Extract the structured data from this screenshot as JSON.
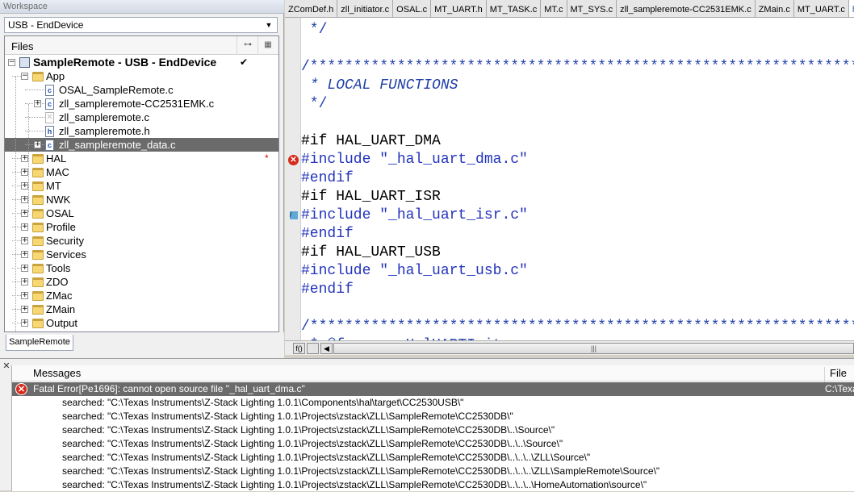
{
  "workspace": {
    "title": "Workspace",
    "config_select": "USB - EndDevice",
    "files_header": "Files",
    "tree": [
      {
        "label": "SampleRemote - USB - EndDevice",
        "type": "project",
        "level": 0,
        "expander": "−",
        "mark": "✔"
      },
      {
        "label": "App",
        "type": "folder",
        "level": 1,
        "expander": "−"
      },
      {
        "label": "OSAL_SampleRemote.c",
        "type": "file",
        "level": 2,
        "expander": ""
      },
      {
        "label": "zll_sampleremote-CC2531EMK.c",
        "type": "file",
        "level": 2,
        "expander": "+"
      },
      {
        "label": "zll_sampleremote.c",
        "type": "file-x",
        "level": 2,
        "expander": ""
      },
      {
        "label": "zll_sampleremote.h",
        "type": "file",
        "level": 2,
        "expander": ""
      },
      {
        "label": "zll_sampleremote_data.c",
        "type": "file",
        "level": 2,
        "expander": "+",
        "selected": true
      },
      {
        "label": "HAL",
        "type": "folder",
        "level": 1,
        "expander": "+",
        "mark": "*"
      },
      {
        "label": "MAC",
        "type": "folder",
        "level": 1,
        "expander": "+"
      },
      {
        "label": "MT",
        "type": "folder",
        "level": 1,
        "expander": "+"
      },
      {
        "label": "NWK",
        "type": "folder",
        "level": 1,
        "expander": "+"
      },
      {
        "label": "OSAL",
        "type": "folder",
        "level": 1,
        "expander": "+"
      },
      {
        "label": "Profile",
        "type": "folder",
        "level": 1,
        "expander": "+"
      },
      {
        "label": "Security",
        "type": "folder",
        "level": 1,
        "expander": "+"
      },
      {
        "label": "Services",
        "type": "folder",
        "level": 1,
        "expander": "+"
      },
      {
        "label": "Tools",
        "type": "folder",
        "level": 1,
        "expander": "+"
      },
      {
        "label": "ZDO",
        "type": "folder",
        "level": 1,
        "expander": "+"
      },
      {
        "label": "ZMac",
        "type": "folder",
        "level": 1,
        "expander": "+"
      },
      {
        "label": "ZMain",
        "type": "folder",
        "level": 1,
        "expander": "+"
      },
      {
        "label": "Output",
        "type": "folder",
        "level": 1,
        "expander": "+"
      }
    ],
    "bottom_tab": "SampleRemote"
  },
  "editor": {
    "tabs": [
      {
        "label": "ZComDef.h"
      },
      {
        "label": "zll_initiator.c"
      },
      {
        "label": "OSAL.c"
      },
      {
        "label": "MT_UART.h"
      },
      {
        "label": "MT_TASK.c"
      },
      {
        "label": "MT.c"
      },
      {
        "label": "MT_SYS.c"
      },
      {
        "label": "zll_sampleremote-CC2531EMK.c"
      },
      {
        "label": "ZMain.c"
      },
      {
        "label": "MT_UART.c"
      },
      {
        "label": "hal_u",
        "active": true
      }
    ],
    "code_lines": [
      {
        "text": " */",
        "cls": "comment"
      },
      {
        "text": "",
        "cls": ""
      },
      {
        "text": "/*******************************************************************",
        "cls": "comment"
      },
      {
        "text": " * LOCAL FUNCTIONS",
        "cls": "comment it"
      },
      {
        "text": " */",
        "cls": "comment"
      },
      {
        "text": "",
        "cls": ""
      },
      {
        "text": "#if HAL_UART_DMA",
        "cls": "kw"
      },
      {
        "text": "#include \"_hal_uart_dma.c\"",
        "cls": "pp",
        "marker": "error"
      },
      {
        "text": "#endif",
        "cls": "pp"
      },
      {
        "text": "#if HAL_UART_ISR",
        "cls": "kw"
      },
      {
        "text": "#include \"_hal_uart_isr.c\"",
        "cls": "pp",
        "marker": "bookmark"
      },
      {
        "text": "#endif",
        "cls": "pp"
      },
      {
        "text": "#if HAL_UART_USB",
        "cls": "kw"
      },
      {
        "text": "#include \"_hal_uart_usb.c\"",
        "cls": "pp"
      },
      {
        "text": "#endif",
        "cls": "pp"
      },
      {
        "text": "",
        "cls": ""
      },
      {
        "text": "/*******************************************************************",
        "cls": "comment"
      },
      {
        "text": " * @fn      HalUARTInit",
        "cls": "comment"
      }
    ],
    "scroll_label": "f()"
  },
  "messages": {
    "col_messages": "Messages",
    "col_file": "File",
    "rows": [
      {
        "text": "Fatal Error[Pe1696]: cannot open source file \"_hal_uart_dma.c\"",
        "file": "C:\\Texas",
        "error": true,
        "selected": true
      },
      {
        "text": "searched: \"C:\\Texas Instruments\\Z-Stack Lighting 1.0.1\\Components\\hal\\target\\CC2530USB\\\"",
        "file": ""
      },
      {
        "text": "searched: \"C:\\Texas Instruments\\Z-Stack Lighting 1.0.1\\Projects\\zstack\\ZLL\\SampleRemote\\CC2530DB\\\"",
        "file": ""
      },
      {
        "text": "searched: \"C:\\Texas Instruments\\Z-Stack Lighting 1.0.1\\Projects\\zstack\\ZLL\\SampleRemote\\CC2530DB\\..\\Source\\\"",
        "file": ""
      },
      {
        "text": "searched: \"C:\\Texas Instruments\\Z-Stack Lighting 1.0.1\\Projects\\zstack\\ZLL\\SampleRemote\\CC2530DB\\..\\..\\Source\\\"",
        "file": ""
      },
      {
        "text": "searched: \"C:\\Texas Instruments\\Z-Stack Lighting 1.0.1\\Projects\\zstack\\ZLL\\SampleRemote\\CC2530DB\\..\\..\\..\\ZLL\\Source\\\"",
        "file": ""
      },
      {
        "text": "searched: \"C:\\Texas Instruments\\Z-Stack Lighting 1.0.1\\Projects\\zstack\\ZLL\\SampleRemote\\CC2530DB\\..\\..\\..\\ZLL\\SampleRemote\\Source\\\"",
        "file": ""
      },
      {
        "text": "searched: \"C:\\Texas Instruments\\Z-Stack Lighting 1.0.1\\Projects\\zstack\\ZLL\\SampleRemote\\CC2530DB\\..\\..\\..\\HomeAutomation\\source\\\"",
        "file": ""
      }
    ]
  }
}
